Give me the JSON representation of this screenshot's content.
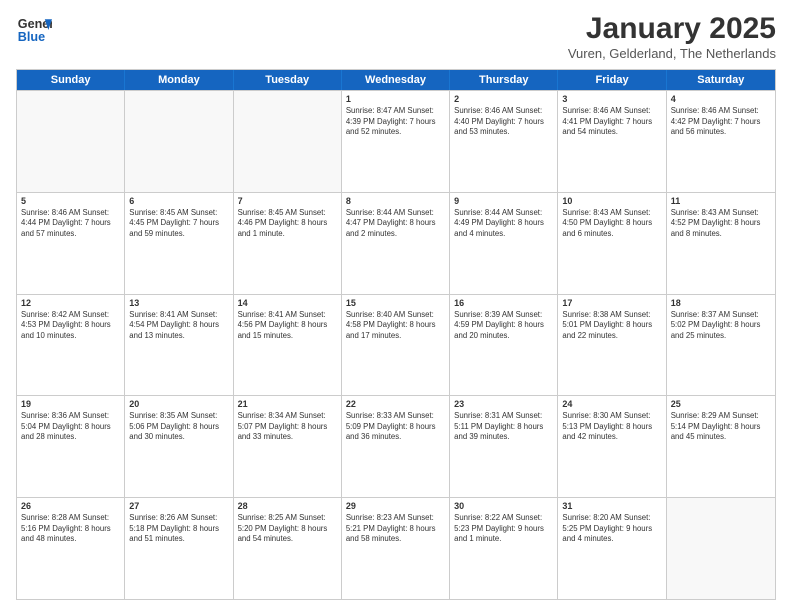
{
  "header": {
    "logo_line1": "General",
    "logo_line2": "Blue",
    "month": "January 2025",
    "location": "Vuren, Gelderland, The Netherlands"
  },
  "weekdays": [
    "Sunday",
    "Monday",
    "Tuesday",
    "Wednesday",
    "Thursday",
    "Friday",
    "Saturday"
  ],
  "weeks": [
    [
      {
        "day": "",
        "info": ""
      },
      {
        "day": "",
        "info": ""
      },
      {
        "day": "",
        "info": ""
      },
      {
        "day": "1",
        "info": "Sunrise: 8:47 AM\nSunset: 4:39 PM\nDaylight: 7 hours and 52 minutes."
      },
      {
        "day": "2",
        "info": "Sunrise: 8:46 AM\nSunset: 4:40 PM\nDaylight: 7 hours and 53 minutes."
      },
      {
        "day": "3",
        "info": "Sunrise: 8:46 AM\nSunset: 4:41 PM\nDaylight: 7 hours and 54 minutes."
      },
      {
        "day": "4",
        "info": "Sunrise: 8:46 AM\nSunset: 4:42 PM\nDaylight: 7 hours and 56 minutes."
      }
    ],
    [
      {
        "day": "5",
        "info": "Sunrise: 8:46 AM\nSunset: 4:44 PM\nDaylight: 7 hours and 57 minutes."
      },
      {
        "day": "6",
        "info": "Sunrise: 8:45 AM\nSunset: 4:45 PM\nDaylight: 7 hours and 59 minutes."
      },
      {
        "day": "7",
        "info": "Sunrise: 8:45 AM\nSunset: 4:46 PM\nDaylight: 8 hours and 1 minute."
      },
      {
        "day": "8",
        "info": "Sunrise: 8:44 AM\nSunset: 4:47 PM\nDaylight: 8 hours and 2 minutes."
      },
      {
        "day": "9",
        "info": "Sunrise: 8:44 AM\nSunset: 4:49 PM\nDaylight: 8 hours and 4 minutes."
      },
      {
        "day": "10",
        "info": "Sunrise: 8:43 AM\nSunset: 4:50 PM\nDaylight: 8 hours and 6 minutes."
      },
      {
        "day": "11",
        "info": "Sunrise: 8:43 AM\nSunset: 4:52 PM\nDaylight: 8 hours and 8 minutes."
      }
    ],
    [
      {
        "day": "12",
        "info": "Sunrise: 8:42 AM\nSunset: 4:53 PM\nDaylight: 8 hours and 10 minutes."
      },
      {
        "day": "13",
        "info": "Sunrise: 8:41 AM\nSunset: 4:54 PM\nDaylight: 8 hours and 13 minutes."
      },
      {
        "day": "14",
        "info": "Sunrise: 8:41 AM\nSunset: 4:56 PM\nDaylight: 8 hours and 15 minutes."
      },
      {
        "day": "15",
        "info": "Sunrise: 8:40 AM\nSunset: 4:58 PM\nDaylight: 8 hours and 17 minutes."
      },
      {
        "day": "16",
        "info": "Sunrise: 8:39 AM\nSunset: 4:59 PM\nDaylight: 8 hours and 20 minutes."
      },
      {
        "day": "17",
        "info": "Sunrise: 8:38 AM\nSunset: 5:01 PM\nDaylight: 8 hours and 22 minutes."
      },
      {
        "day": "18",
        "info": "Sunrise: 8:37 AM\nSunset: 5:02 PM\nDaylight: 8 hours and 25 minutes."
      }
    ],
    [
      {
        "day": "19",
        "info": "Sunrise: 8:36 AM\nSunset: 5:04 PM\nDaylight: 8 hours and 28 minutes."
      },
      {
        "day": "20",
        "info": "Sunrise: 8:35 AM\nSunset: 5:06 PM\nDaylight: 8 hours and 30 minutes."
      },
      {
        "day": "21",
        "info": "Sunrise: 8:34 AM\nSunset: 5:07 PM\nDaylight: 8 hours and 33 minutes."
      },
      {
        "day": "22",
        "info": "Sunrise: 8:33 AM\nSunset: 5:09 PM\nDaylight: 8 hours and 36 minutes."
      },
      {
        "day": "23",
        "info": "Sunrise: 8:31 AM\nSunset: 5:11 PM\nDaylight: 8 hours and 39 minutes."
      },
      {
        "day": "24",
        "info": "Sunrise: 8:30 AM\nSunset: 5:13 PM\nDaylight: 8 hours and 42 minutes."
      },
      {
        "day": "25",
        "info": "Sunrise: 8:29 AM\nSunset: 5:14 PM\nDaylight: 8 hours and 45 minutes."
      }
    ],
    [
      {
        "day": "26",
        "info": "Sunrise: 8:28 AM\nSunset: 5:16 PM\nDaylight: 8 hours and 48 minutes."
      },
      {
        "day": "27",
        "info": "Sunrise: 8:26 AM\nSunset: 5:18 PM\nDaylight: 8 hours and 51 minutes."
      },
      {
        "day": "28",
        "info": "Sunrise: 8:25 AM\nSunset: 5:20 PM\nDaylight: 8 hours and 54 minutes."
      },
      {
        "day": "29",
        "info": "Sunrise: 8:23 AM\nSunset: 5:21 PM\nDaylight: 8 hours and 58 minutes."
      },
      {
        "day": "30",
        "info": "Sunrise: 8:22 AM\nSunset: 5:23 PM\nDaylight: 9 hours and 1 minute."
      },
      {
        "day": "31",
        "info": "Sunrise: 8:20 AM\nSunset: 5:25 PM\nDaylight: 9 hours and 4 minutes."
      },
      {
        "day": "",
        "info": ""
      }
    ]
  ]
}
